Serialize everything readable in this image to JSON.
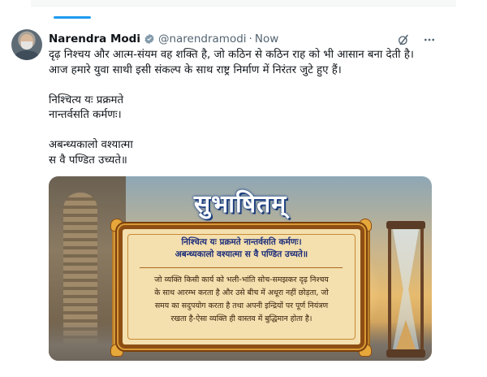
{
  "author": {
    "name": "Narendra Modi",
    "handle": "@narendramodi",
    "separator": "·",
    "time": "Now"
  },
  "icons": {
    "verified": "verified-badge-icon",
    "grok": "grok-slash-icon",
    "more": "more-icon"
  },
  "colors": {
    "accent": "#1d9bf0",
    "text": "#0f1419",
    "muted": "#536471"
  },
  "post": {
    "lines": [
      "दृढ़ निश्चय और आत्म-संयम वह शक्ति है, जो कठिन से कठिन राह को भी आसान बना देती है।",
      "आज हमारे युवा साथी इसी संकल्प के साथ राष्ट्र निर्माण में निरंतर जुटे हुए हैं।",
      "",
      "निश्चित्य यः प्रक्रमते",
      "नान्तर्वसति कर्मणः।",
      "",
      "अबन्ध्यकालो वश्यात्मा",
      "स वै पण्डित उच्यते॥"
    ]
  },
  "image": {
    "title": "सुभाषितम्",
    "shloka_line1": "निश्चित्य यः प्रक्रमते नान्तर्वसति कर्मणः।",
    "shloka_line2": "अबन्ध्यकालो वश्यात्मा स वै पण्डित उच्यते॥",
    "meaning_line1": "जो व्यक्ति किसी कार्य को भली-भांति सोच-समझकर दृढ़ निश्चय",
    "meaning_line2": "के साथ आरम्भ करता है और उसे बीच में अधूरा नहीं छोड़ता, जो",
    "meaning_line3": "समय का सदुपयोग करता है तथा अपनी इन्द्रियों पर पूर्ण नियंत्रण",
    "meaning_line4": "रखता है-ऐसा व्यक्ति ही वास्तव में बुद्धिमान होता है।"
  }
}
